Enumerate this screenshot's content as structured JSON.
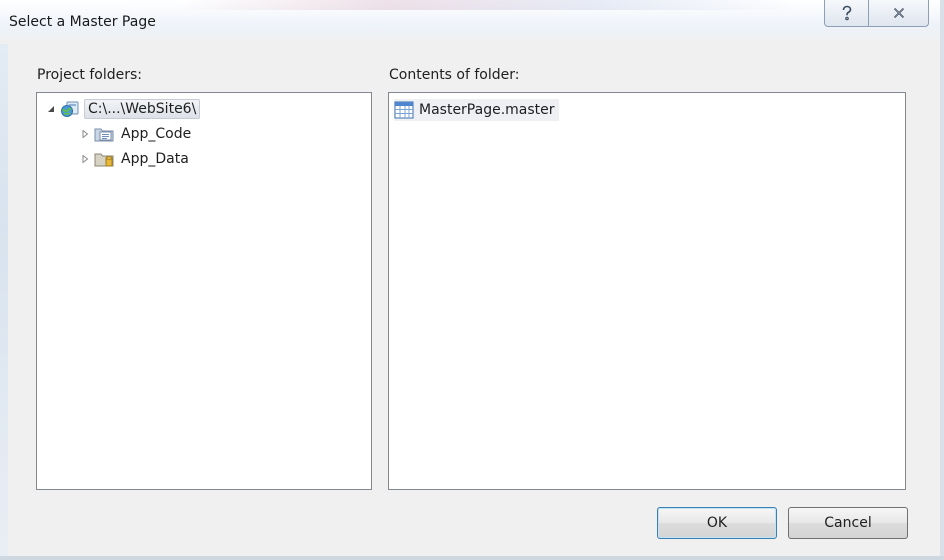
{
  "dialog": {
    "title": "Select a Master Page",
    "help_symbol": "?",
    "close_symbol": "✕"
  },
  "project_folders": {
    "label": "Project folders:",
    "tree": [
      {
        "label": "C:\\...\\WebSite6\\",
        "icon": "website-icon",
        "expanded": true,
        "selected": true
      },
      {
        "label": "App_Code",
        "icon": "code-folder-icon",
        "expanded": false
      },
      {
        "label": "App_Data",
        "icon": "data-folder-icon",
        "expanded": false
      }
    ]
  },
  "contents": {
    "label": "Contents of folder:",
    "files": [
      {
        "label": "MasterPage.master",
        "icon": "master-page-icon"
      }
    ]
  },
  "buttons": {
    "ok": "OK",
    "cancel": "Cancel"
  },
  "colors": {
    "accent": "#3c7fb1",
    "panel_border": "#828790",
    "background": "#f0f0f0"
  }
}
